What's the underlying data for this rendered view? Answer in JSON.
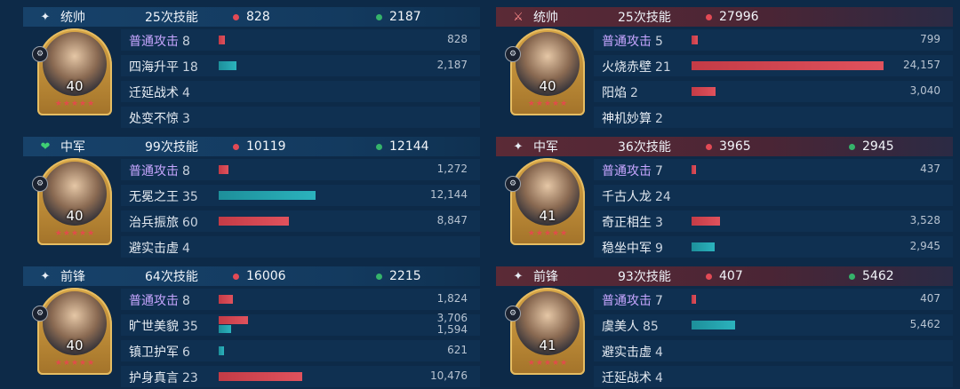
{
  "max_value": 24157,
  "colors": {
    "damage": "#e24a55",
    "heal": "#35b36a",
    "skill_name_special": "#c7a6ff"
  },
  "teams": [
    {
      "side": "left",
      "heroes": [
        {
          "role": "统帅",
          "role_icon": "general-icon",
          "skills_count": "25次技能",
          "damage": "828",
          "heal": "2187",
          "level": "40",
          "skills": [
            {
              "name": "普通攻击",
              "count": "8",
              "special": true,
              "damage": 828,
              "damage_text": "828",
              "heal": 0,
              "heal_text": ""
            },
            {
              "name": "四海升平",
              "count": "18",
              "special": false,
              "damage": 0,
              "damage_text": "",
              "heal": 2187,
              "heal_text": "2,187"
            },
            {
              "name": "迁延战术",
              "count": "4",
              "special": false,
              "damage": 0,
              "damage_text": "",
              "heal": 0,
              "heal_text": ""
            },
            {
              "name": "处变不惊",
              "count": "3",
              "special": false,
              "damage": 0,
              "damage_text": "",
              "heal": 0,
              "heal_text": ""
            }
          ]
        },
        {
          "role": "中军",
          "role_icon": "heart-shield-icon",
          "skills_count": "99次技能",
          "damage": "10119",
          "heal": "12144",
          "level": "40",
          "skills": [
            {
              "name": "普通攻击",
              "count": "8",
              "special": true,
              "damage": 1272,
              "damage_text": "1,272",
              "heal": 0,
              "heal_text": ""
            },
            {
              "name": "无冕之王",
              "count": "35",
              "special": false,
              "damage": 0,
              "damage_text": "",
              "heal": 12144,
              "heal_text": "12,144"
            },
            {
              "name": "治兵振旅",
              "count": "60",
              "special": false,
              "damage": 8847,
              "damage_text": "8,847",
              "heal": 0,
              "heal_text": ""
            },
            {
              "name": "避实击虚",
              "count": "4",
              "special": false,
              "damage": 0,
              "damage_text": "",
              "heal": 0,
              "heal_text": ""
            }
          ]
        },
        {
          "role": "前锋",
          "role_icon": "vanguard-icon",
          "skills_count": "64次技能",
          "damage": "16006",
          "heal": "2215",
          "level": "40",
          "skills": [
            {
              "name": "普通攻击",
              "count": "8",
              "special": true,
              "damage": 1824,
              "damage_text": "1,824",
              "heal": 0,
              "heal_text": ""
            },
            {
              "name": "旷世美貌",
              "count": "35",
              "special": false,
              "damage": 3706,
              "damage_text": "3,706",
              "heal": 1594,
              "heal_text": "1,594"
            },
            {
              "name": "镇卫护军",
              "count": "6",
              "special": false,
              "damage": 0,
              "damage_text": "",
              "heal": 621,
              "heal_text": "621"
            },
            {
              "name": "护身真言",
              "count": "23",
              "special": false,
              "damage": 10476,
              "damage_text": "10,476",
              "heal": 0,
              "heal_text": ""
            }
          ]
        }
      ]
    },
    {
      "side": "right",
      "heroes": [
        {
          "role": "统帅",
          "role_icon": "sword-badge-icon",
          "skills_count": "25次技能",
          "damage": "27996",
          "heal": "",
          "level": "40",
          "skills": [
            {
              "name": "普通攻击",
              "count": "5",
              "special": true,
              "damage": 799,
              "damage_text": "799",
              "heal": 0,
              "heal_text": ""
            },
            {
              "name": "火烧赤壁",
              "count": "21",
              "special": false,
              "damage": 24157,
              "damage_text": "24,157",
              "heal": 0,
              "heal_text": ""
            },
            {
              "name": "阳焰",
              "count": "2",
              "special": false,
              "damage": 3040,
              "damage_text": "3,040",
              "heal": 0,
              "heal_text": ""
            },
            {
              "name": "神机妙算",
              "count": "2",
              "special": false,
              "damage": 0,
              "damage_text": "",
              "heal": 0,
              "heal_text": ""
            }
          ]
        },
        {
          "role": "中军",
          "role_icon": "vanguard-icon",
          "skills_count": "36次技能",
          "damage": "3965",
          "heal": "2945",
          "level": "41",
          "skills": [
            {
              "name": "普通攻击",
              "count": "7",
              "special": true,
              "damage": 437,
              "damage_text": "437",
              "heal": 0,
              "heal_text": ""
            },
            {
              "name": "千古人龙",
              "count": "24",
              "special": false,
              "damage": 0,
              "damage_text": "",
              "heal": 0,
              "heal_text": ""
            },
            {
              "name": "奇正相生",
              "count": "3",
              "special": false,
              "damage": 3528,
              "damage_text": "3,528",
              "heal": 0,
              "heal_text": ""
            },
            {
              "name": "稳坐中军",
              "count": "9",
              "special": false,
              "damage": 0,
              "damage_text": "",
              "heal": 2945,
              "heal_text": "2,945"
            }
          ]
        },
        {
          "role": "前锋",
          "role_icon": "vanguard-icon",
          "skills_count": "93次技能",
          "damage": "407",
          "heal": "5462",
          "level": "41",
          "skills": [
            {
              "name": "普通攻击",
              "count": "7",
              "special": true,
              "damage": 407,
              "damage_text": "407",
              "heal": 0,
              "heal_text": ""
            },
            {
              "name": "虞美人",
              "count": "85",
              "special": false,
              "damage": 0,
              "damage_text": "",
              "heal": 5462,
              "heal_text": "5,462"
            },
            {
              "name": "避实击虚",
              "count": "4",
              "special": false,
              "damage": 0,
              "damage_text": "",
              "heal": 0,
              "heal_text": ""
            },
            {
              "name": "迁延战术",
              "count": "4",
              "special": false,
              "damage": 0,
              "damage_text": "",
              "heal": 0,
              "heal_text": ""
            }
          ]
        }
      ]
    }
  ]
}
